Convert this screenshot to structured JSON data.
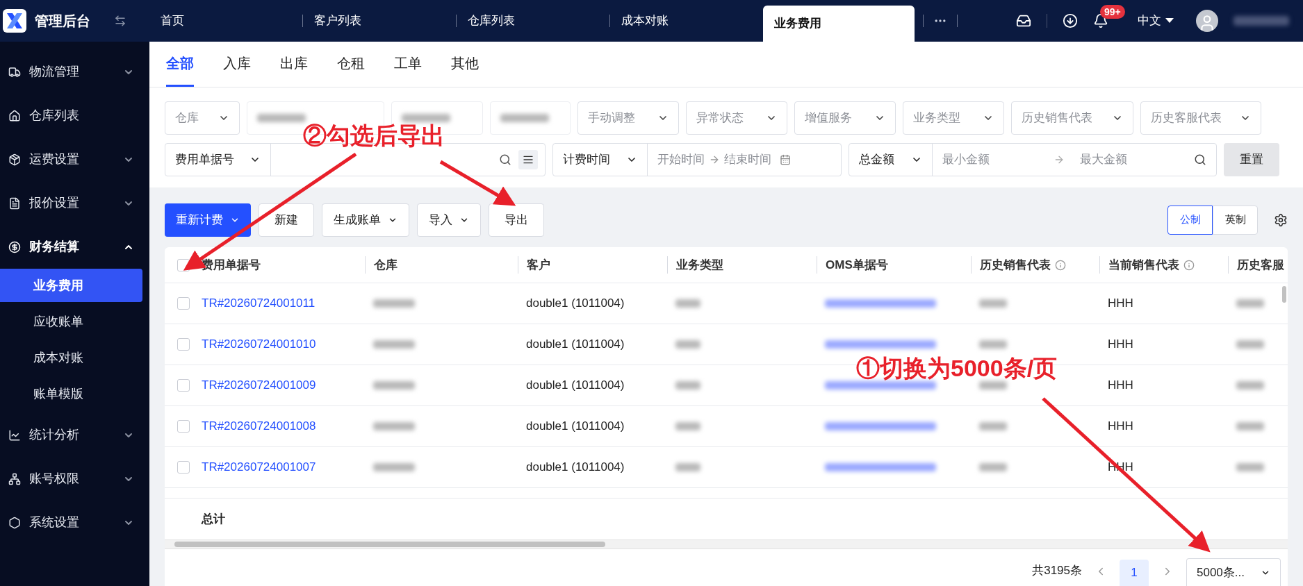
{
  "app": {
    "title": "管理后台"
  },
  "header_tabs": [
    {
      "label": "首页",
      "selected": false
    },
    {
      "label": "客户列表",
      "selected": false
    },
    {
      "label": "仓库列表",
      "selected": false
    },
    {
      "label": "成本对账",
      "selected": false
    },
    {
      "label": "业务费用",
      "selected": true
    }
  ],
  "header": {
    "notifications": "99+",
    "language": "中文"
  },
  "sidebar": {
    "items": [
      {
        "label": "物流管理",
        "expanded": false
      },
      {
        "label": "仓库列表"
      },
      {
        "label": "运费设置",
        "expanded": false
      },
      {
        "label": "报价设置",
        "expanded": false
      },
      {
        "label": "财务结算",
        "expanded": true,
        "children": [
          {
            "label": "业务费用",
            "selected": true
          },
          {
            "label": "应收账单",
            "selected": false
          },
          {
            "label": "成本对账",
            "selected": false
          },
          {
            "label": "账单模版",
            "selected": false
          }
        ]
      },
      {
        "label": "统计分析",
        "expanded": false
      },
      {
        "label": "账号权限",
        "expanded": false
      },
      {
        "label": "系统设置",
        "expanded": false
      }
    ]
  },
  "sub_tabs": [
    {
      "label": "全部",
      "selected": true
    },
    {
      "label": "入库",
      "selected": false
    },
    {
      "label": "出库",
      "selected": false
    },
    {
      "label": "仓租",
      "selected": false
    },
    {
      "label": "工单",
      "selected": false
    },
    {
      "label": "其他",
      "selected": false
    }
  ],
  "filters": [
    {
      "kind": "select",
      "placeholder": "仓库"
    },
    {
      "kind": "redacted"
    },
    {
      "kind": "redacted"
    },
    {
      "kind": "redacted"
    },
    {
      "kind": "select",
      "placeholder": "手动调整"
    },
    {
      "kind": "select",
      "placeholder": "异常状态"
    },
    {
      "kind": "select",
      "placeholder": "增值服务"
    },
    {
      "kind": "select",
      "placeholder": "业务类型"
    },
    {
      "kind": "select",
      "placeholder": "历史销售代表"
    },
    {
      "kind": "select",
      "placeholder": "历史客服代表"
    }
  ],
  "search": {
    "field": "费用单据号",
    "date_field": "计费时间",
    "start_placeholder": "开始时间",
    "end_placeholder": "结束时间",
    "amount_field": "总金额",
    "min_placeholder": "最小金额",
    "max_placeholder": "最大金额",
    "reset": "重置"
  },
  "actions": [
    {
      "label": "重新计费",
      "primary": true,
      "dropdown": true
    },
    {
      "label": "新建",
      "primary": false,
      "dropdown": false
    },
    {
      "label": "生成账单",
      "primary": false,
      "dropdown": true
    },
    {
      "label": "导入",
      "primary": false,
      "dropdown": true
    },
    {
      "label": "导出",
      "primary": false,
      "dropdown": false
    }
  ],
  "units": [
    {
      "label": "公制",
      "selected": true
    },
    {
      "label": "英制",
      "selected": false
    }
  ],
  "table": {
    "select_all_checked": false,
    "columns": [
      {
        "label": "费用单据号",
        "info": false
      },
      {
        "label": "仓库",
        "info": false
      },
      {
        "label": "客户",
        "info": false
      },
      {
        "label": "业务类型",
        "info": false
      },
      {
        "label": "OMS单据号",
        "info": false
      },
      {
        "label": "历史销售代表",
        "info": true
      },
      {
        "label": "当前销售代表",
        "info": true
      },
      {
        "label": "历史客服"
      }
    ],
    "rows": [
      {
        "checked": false,
        "number": "TR#20260724001011",
        "customer": "double1 (1011004)",
        "current_rep": "HHH"
      },
      {
        "checked": false,
        "number": "TR#20260724001010",
        "customer": "double1 (1011004)",
        "current_rep": "HHH"
      },
      {
        "checked": false,
        "number": "TR#20260724001009",
        "customer": "double1 (1011004)",
        "current_rep": "HHH"
      },
      {
        "checked": false,
        "number": "TR#20260724001008",
        "customer": "double1 (1011004)",
        "current_rep": "HHH"
      },
      {
        "checked": false,
        "number": "TR#20260724001007",
        "customer": "double1 (1011004)",
        "current_rep": "HHH"
      }
    ],
    "total_label": "总计"
  },
  "pagination": {
    "total": "共3195条",
    "pages": [
      {
        "label": "1",
        "selected": true
      }
    ],
    "page_size": "5000条..."
  },
  "annotations": [
    {
      "text": "②勾选后导出"
    },
    {
      "text": "①切换为5000条/页"
    }
  ]
}
